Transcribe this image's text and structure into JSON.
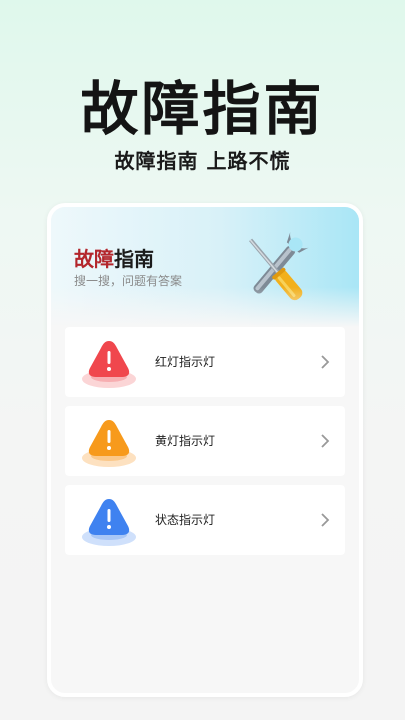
{
  "hero": {
    "title": "故障指南",
    "subtitle": "故障指南 上路不慌"
  },
  "banner": {
    "title_part1": "故障",
    "title_part2": "指南",
    "subtitle": "搜一搜，问题有答案"
  },
  "items": [
    {
      "label": "红灯指示灯",
      "icon": "red-warning-icon",
      "color": "#f0474d"
    },
    {
      "label": "黄灯指示灯",
      "icon": "yellow-warning-icon",
      "color": "#f79a1c"
    },
    {
      "label": "状态指示灯",
      "icon": "blue-warning-icon",
      "color": "#3f82f0"
    }
  ]
}
